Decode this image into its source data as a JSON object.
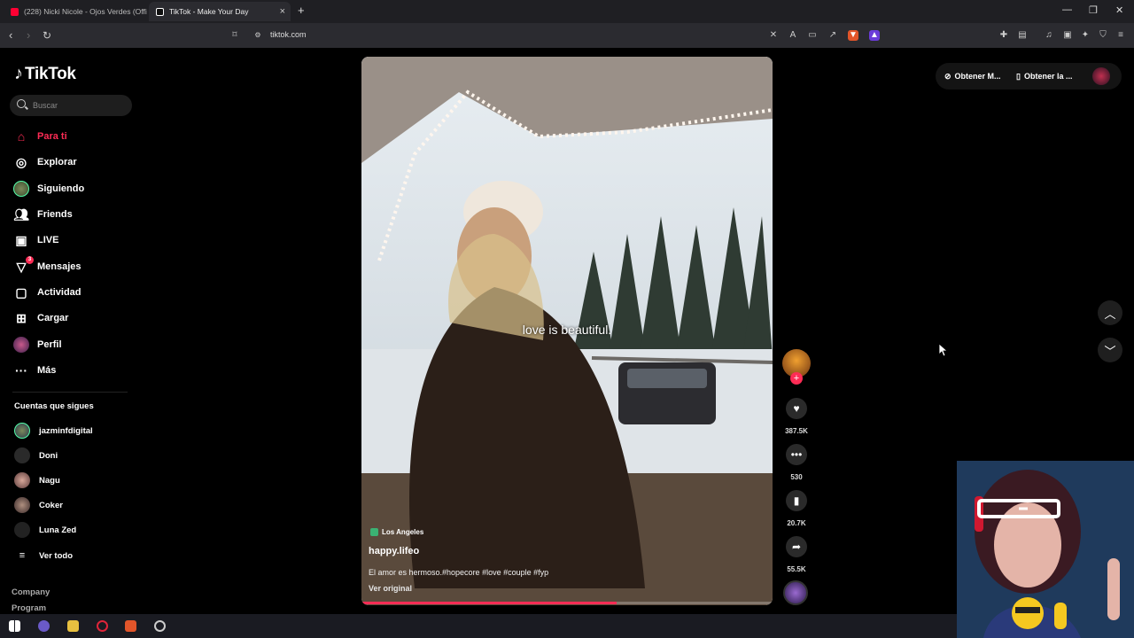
{
  "browser": {
    "tabs": [
      {
        "title": "(228) Nicki Nicole - Ojos Verdes (Offi",
        "favicon_color": "#ff0033"
      },
      {
        "title": "TikTok - Make Your Day",
        "favicon_color": "#111111"
      }
    ],
    "new_tab": "+",
    "address": "tiktok.com"
  },
  "sidebar": {
    "logo": "TikTok",
    "search_placeholder": "Buscar",
    "nav": [
      {
        "label": "Para ti",
        "icon": "home-icon"
      },
      {
        "label": "Explorar",
        "icon": "compass-icon"
      },
      {
        "label": "Siguiendo",
        "icon": "following-avatar-icon"
      },
      {
        "label": "Friends",
        "icon": "friends-icon"
      },
      {
        "label": "LIVE",
        "icon": "live-icon"
      },
      {
        "label": "Mensajes",
        "icon": "send-icon",
        "badge": "3"
      },
      {
        "label": "Actividad",
        "icon": "activity-icon"
      },
      {
        "label": "Cargar",
        "icon": "upload-icon"
      },
      {
        "label": "Perfil",
        "icon": "profile-avatar-icon"
      },
      {
        "label": "Más",
        "icon": "more-icon"
      }
    ],
    "following_heading": "Cuentas que sigues",
    "following": [
      {
        "name": "jazminfdigital"
      },
      {
        "name": "Doni"
      },
      {
        "name": "Nagu"
      },
      {
        "name": "Coker"
      },
      {
        "name": "Luna Zed"
      }
    ],
    "see_all": "Ver todo",
    "footer": [
      "Company",
      "Program"
    ]
  },
  "video": {
    "overlay_caption": "love is beautiful.",
    "location": "Los Angeles",
    "author": "happy.lifeo",
    "description": "El amor es hermoso.#hopecore #love #couple #fyp",
    "see_original": "Ver original",
    "progress": 0.62
  },
  "actions": {
    "likes": "387.5K",
    "comments": "530",
    "saves": "20.7K",
    "shares": "55.5K"
  },
  "topbar": {
    "get_coins": "Obtener M...",
    "get_app": "Obtener la ..."
  }
}
